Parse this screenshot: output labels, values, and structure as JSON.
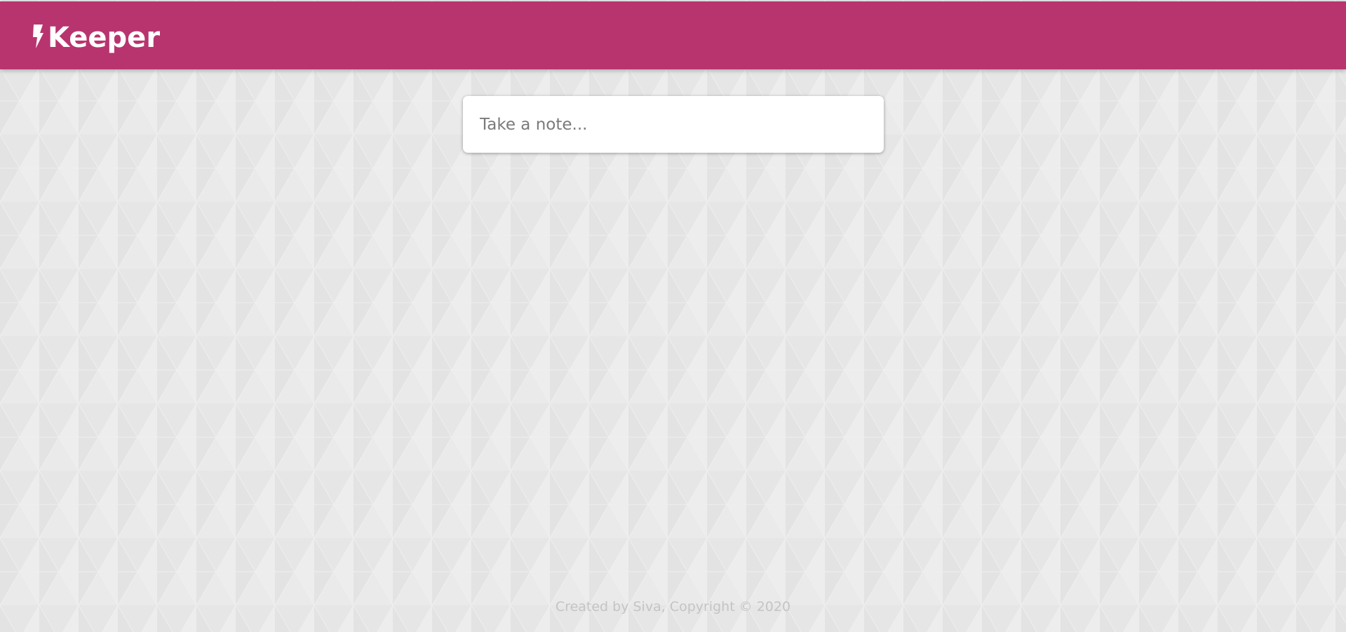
{
  "header": {
    "title": "Keeper",
    "logo_icon": "lightning-bolt-icon"
  },
  "note_form": {
    "placeholder": "Take a note..."
  },
  "footer": {
    "text": "Created by Siva, Copyright © 2020"
  },
  "colors": {
    "header_bg": "#b8346f",
    "page_bg": "#e8e8e8",
    "card_bg": "#ffffff",
    "footer_text": "#c4c4c4"
  }
}
